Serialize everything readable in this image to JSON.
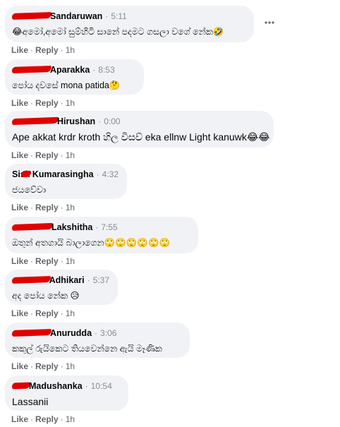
{
  "comments": [
    {
      "author": "Sandaruwan",
      "time": "5:11",
      "text": "😂අමෝ,අමෝ සුම්හිටි සානේ පදමට ගසලා වගේ නේක🤣",
      "like": "Like",
      "reply": "Reply",
      "age": "1h"
    },
    {
      "author": "Aparakka",
      "time": "8:53",
      "text": "පෝය දවසේ mona patida🤔",
      "like": "Like",
      "reply": "Reply",
      "age": "1h"
    },
    {
      "author": "Hirushan",
      "time": "0:00",
      "text": "Ape akkat krdr kroth හිල විසව් eka ellnw Light kanuwk😂😂",
      "like": "Like",
      "reply": "Reply",
      "age": "1h"
    },
    {
      "author": "Kumarasingha",
      "author_visible_prefix": "Sisir",
      "time": "4:32",
      "text": "ජයවේවා",
      "like": "Like",
      "reply": "Reply",
      "age": "1h"
    },
    {
      "author": "Lakshitha",
      "time": "7:55",
      "text": "ඔතුන් අතගායි බාලාගෙන🙄🙄🙄🙄🙄🙄",
      "like": "Like",
      "reply": "Reply",
      "age": "1h"
    },
    {
      "author": "Adhikari",
      "time": "5:37",
      "text": "අද පෝය නේක 😥",
      "like": "Like",
      "reply": "Reply",
      "age": "1h"
    },
    {
      "author": "Anurudda",
      "time": "3:06",
      "text": "කකුල් රුයිකෙට තියවෙන්නෙ ඇයි මෑණික",
      "like": "Like",
      "reply": "Reply",
      "age": "1h"
    },
    {
      "author": "Madushanka",
      "time": "10:54",
      "text": "Lassanii",
      "like": "Like",
      "reply": "Reply",
      "age": "1h"
    }
  ],
  "more_icon": "more-horizontal-icon",
  "separator": "·",
  "colors": {
    "bubble": "#f0f2f5",
    "meta": "#65676b",
    "time": "#8a8d91",
    "redaction": "#e10000"
  }
}
